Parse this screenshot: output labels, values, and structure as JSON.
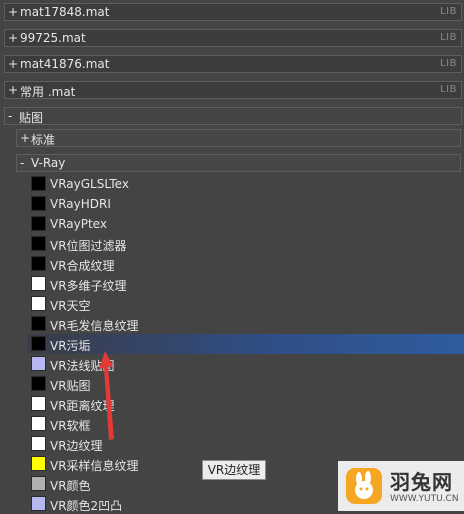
{
  "libraries": [
    {
      "expander": "+",
      "name": "mat17848.mat",
      "tag": "LIB"
    },
    {
      "expander": "+",
      "name": "99725.mat",
      "tag": "LIB"
    },
    {
      "expander": "+",
      "name": "mat41876.mat",
      "tag": "LIB"
    },
    {
      "expander": "+",
      "name": "常用 .mat",
      "tag": "LIB"
    }
  ],
  "maps_group": {
    "expander": "-",
    "name": "贴图"
  },
  "standard_group": {
    "expander": "+",
    "name": "标准"
  },
  "vray_group": {
    "expander": "-",
    "name": "V-Ray"
  },
  "items": [
    {
      "label": "VRayGLSLTex",
      "swatch": "#000000"
    },
    {
      "label": "VRayHDRI",
      "swatch": "#000000"
    },
    {
      "label": "VRayPtex",
      "swatch": "#000000"
    },
    {
      "label": "VR位图过滤器",
      "swatch": "#000000"
    },
    {
      "label": "VR合成纹理",
      "swatch": "#000000"
    },
    {
      "label": "VR多维子纹理",
      "swatch": "#ffffff"
    },
    {
      "label": "VR天空",
      "swatch": "#ffffff"
    },
    {
      "label": "VR毛发信息纹理",
      "swatch": "#000000"
    },
    {
      "label": "VR污垢",
      "swatch": "#000000",
      "highlighted": true
    },
    {
      "label": "VR法线贴图",
      "swatch": "#b8b8f0"
    },
    {
      "label": "VR贴图",
      "swatch": "#000000"
    },
    {
      "label": "VR距离纹理",
      "swatch": "#ffffff"
    },
    {
      "label": "VR软框",
      "swatch": "#ffffff"
    },
    {
      "label": "VR边纹理",
      "swatch": "#ffffff"
    },
    {
      "label": "VR采样信息纹理",
      "swatch": "#ffff00"
    },
    {
      "label": "VR颜色",
      "swatch": "#b0b0b0"
    },
    {
      "label": "VR颜色2凹凸",
      "swatch": "#b8b8f0"
    }
  ],
  "tooltip": "VR边纹理",
  "watermark": {
    "title": "羽兔网",
    "url": "WWW.YUTU.CN"
  },
  "colors": {
    "highlight": "#2f5c9f",
    "arrow": "#e53935",
    "panel_bg": "#444444"
  }
}
